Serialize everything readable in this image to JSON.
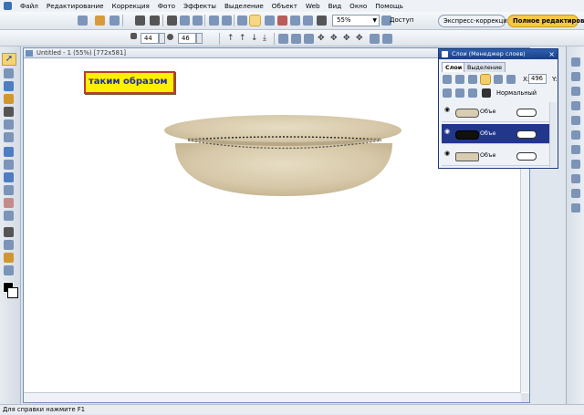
{
  "menu": {
    "items": [
      "Файл",
      "Редактирование",
      "Коррекция",
      "Фото",
      "Эффекты",
      "Выделение",
      "Объект",
      "Web",
      "Вид",
      "Окно",
      "Помощь"
    ]
  },
  "toolbar": {
    "zoom_value": "55%",
    "access_label": "Доступ",
    "express_label": "Экспресс-коррекция",
    "full_label": "Полное редактиров...",
    "size_value": "44",
    "opacity_value": "46"
  },
  "document": {
    "title": "Untitled - 1 (55%) [772x581]",
    "annotation_text": "таким образом"
  },
  "layers": {
    "title": "Слои (Менеджер слоев)",
    "tabs": [
      "Слои",
      "Выделение"
    ],
    "x_label": "X:",
    "x_value": "496",
    "y_label": "Y:",
    "blend_mode": "Нормальный",
    "rows": [
      {
        "name": "Объе"
      },
      {
        "name": "Объе"
      },
      {
        "name": "Объе"
      }
    ]
  },
  "status": {
    "help_text": "Для справки нажмите F1"
  },
  "colors": {
    "accent_blue": "#22378c",
    "annotation_bg": "#ffef00",
    "annotation_border": "#c0392b",
    "full_mode_button": "#f7c844",
    "stone_texture": "#d8ccaf"
  }
}
